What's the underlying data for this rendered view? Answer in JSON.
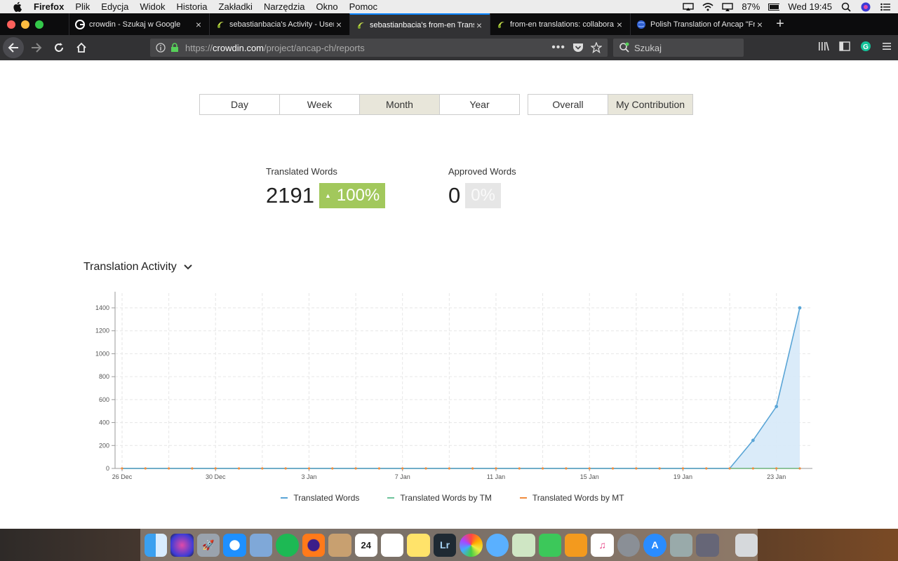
{
  "menubar": {
    "app": "Firefox",
    "items": [
      "Plik",
      "Edycja",
      "Widok",
      "Historia",
      "Zakładki",
      "Narzędzia",
      "Okno",
      "Pomoc"
    ],
    "battery": "87%",
    "clock": "Wed 19:45"
  },
  "tabs": [
    {
      "title": "crowdin - Szukaj w Google",
      "favicon": "google-icon",
      "active": false
    },
    {
      "title": "sebastianbacia's Activity - User",
      "favicon": "crowdin-icon",
      "active": false
    },
    {
      "title": "sebastianbacia's from-en Trans",
      "favicon": "crowdin-icon",
      "active": true
    },
    {
      "title": "from-en translations: collabora",
      "favicon": "crowdin-icon",
      "active": false
    },
    {
      "title": "Polish Translation of Ancap \"Fr",
      "favicon": "globe-icon",
      "active": false
    }
  ],
  "navbar": {
    "url_prefix": "https://",
    "url_domain": "crowdin.com",
    "url_path": "/project/ancap-ch/reports",
    "search_placeholder": "Szukaj"
  },
  "period_tabs": {
    "day": "Day",
    "week": "Week",
    "month": "Month",
    "year": "Year",
    "selected": "Month"
  },
  "scope_tabs": {
    "overall": "Overall",
    "mine": "My Contribution",
    "selected": "My Contribution"
  },
  "stats": {
    "translated": {
      "label": "Translated Words",
      "value": "2191",
      "change": "100%"
    },
    "approved": {
      "label": "Approved Words",
      "value": "0",
      "change": "0%"
    }
  },
  "activity": {
    "title": "Translation Activity"
  },
  "colors": {
    "translated": "#5aa5d6",
    "tm": "#6dc39a",
    "mt": "#f08c3e",
    "badge_green": "#a2c85c"
  },
  "chart_data": {
    "type": "area",
    "title": "",
    "xlabel": "",
    "ylabel": "",
    "ylim": [
      0,
      1500
    ],
    "yticks": [
      0,
      200,
      400,
      600,
      800,
      1000,
      1200,
      1400
    ],
    "x_tick_labels": [
      "26 Dec",
      "30 Dec",
      "3 Jan",
      "7 Jan",
      "11 Jan",
      "15 Jan",
      "19 Jan",
      "23 Jan"
    ],
    "x": [
      "26 Dec",
      "27 Dec",
      "28 Dec",
      "29 Dec",
      "30 Dec",
      "31 Dec",
      "1 Jan",
      "2 Jan",
      "3 Jan",
      "4 Jan",
      "5 Jan",
      "6 Jan",
      "7 Jan",
      "8 Jan",
      "9 Jan",
      "10 Jan",
      "11 Jan",
      "12 Jan",
      "13 Jan",
      "14 Jan",
      "15 Jan",
      "16 Jan",
      "17 Jan",
      "18 Jan",
      "19 Jan",
      "20 Jan",
      "21 Jan",
      "22 Jan",
      "23 Jan",
      "24 Jan"
    ],
    "series": [
      {
        "name": "Translated Words",
        "values": [
          0,
          0,
          0,
          0,
          0,
          0,
          0,
          0,
          0,
          0,
          0,
          0,
          0,
          0,
          0,
          0,
          0,
          0,
          0,
          0,
          0,
          0,
          0,
          0,
          0,
          0,
          0,
          245,
          540,
          1400
        ]
      },
      {
        "name": "Translated Words by TM",
        "values": [
          0,
          0,
          0,
          0,
          0,
          0,
          0,
          0,
          0,
          0,
          0,
          0,
          0,
          0,
          0,
          0,
          0,
          0,
          0,
          0,
          0,
          0,
          0,
          0,
          0,
          0,
          0,
          0,
          0,
          0
        ]
      },
      {
        "name": "Translated Words by MT",
        "values": [
          0,
          0,
          0,
          0,
          0,
          0,
          0,
          0,
          0,
          0,
          0,
          0,
          0,
          0,
          0,
          0,
          0,
          0,
          0,
          0,
          0,
          0,
          0,
          0,
          0,
          0,
          0,
          0,
          0,
          0
        ]
      }
    ]
  }
}
